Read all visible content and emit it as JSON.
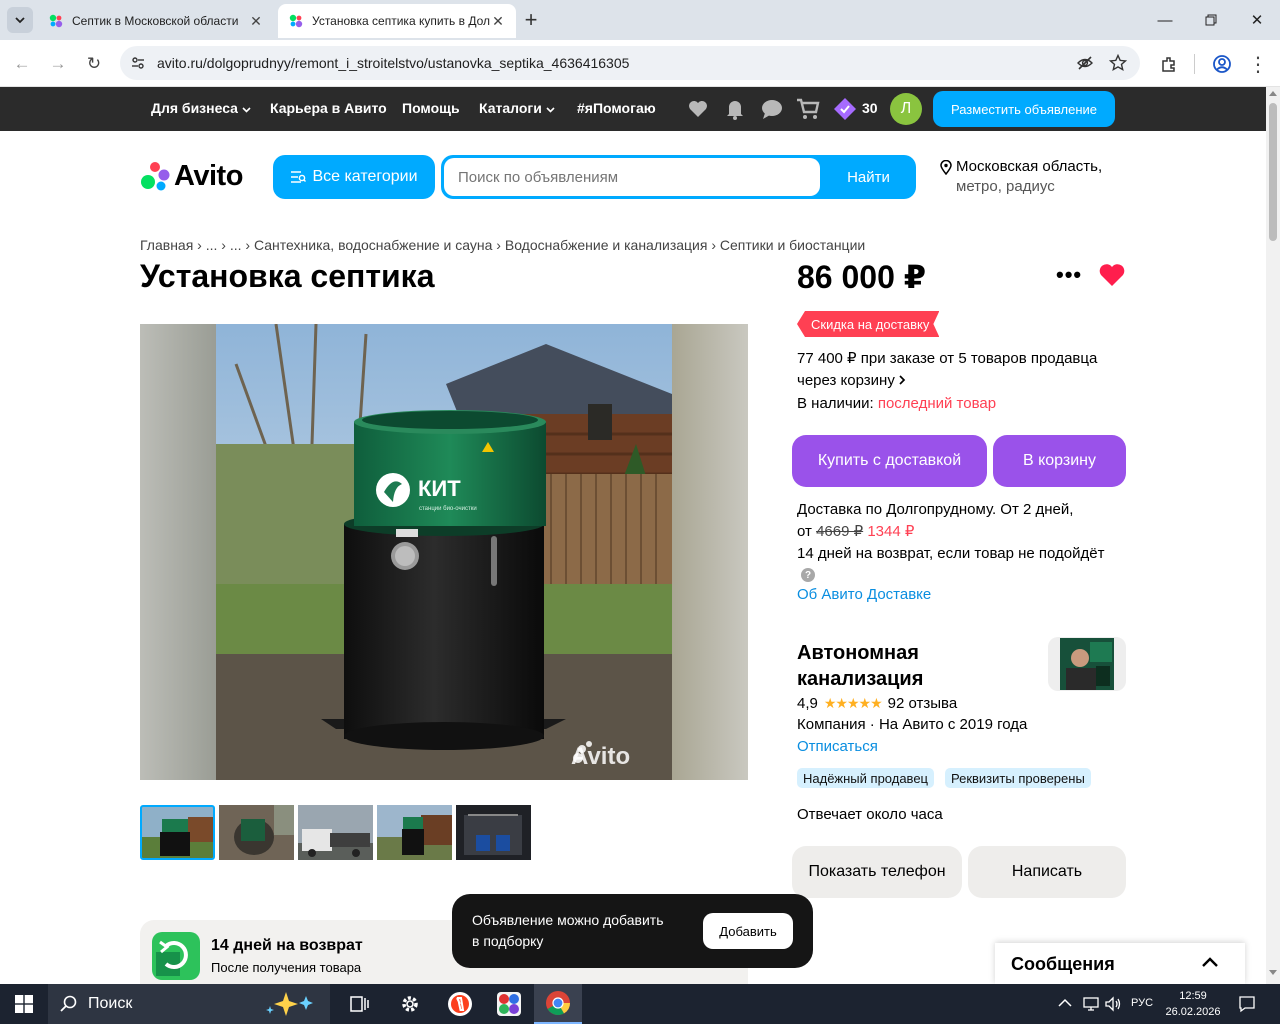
{
  "browser": {
    "tabs": [
      {
        "title": "Септик в Московской области"
      },
      {
        "title": "Установка септика купить в Долгопрудном"
      }
    ],
    "new_tab_symbol": "+",
    "url": "avito.ru/dolgoprudnyy/remont_i_stroitelstvo/ustanovka_septika_4636416305"
  },
  "topnav": {
    "items": [
      "Для бизнеса",
      "Карьера в Авито",
      "Помощь",
      "Каталоги",
      "#яПомогаю"
    ],
    "bonus_count": "30",
    "avatar_letter": "Л",
    "post_button": "Разместить объявление"
  },
  "header": {
    "logo": "Avito",
    "categories_button": "Все категории",
    "search_placeholder": "Поиск по объявлениям",
    "search_button": "Найти",
    "location_line1": "Московская область,",
    "location_line2": "метро, радиус"
  },
  "breadcrumbs": [
    "Главная",
    "...",
    "...",
    "Сантехника, водоснабжение и сауна",
    "Водоснабжение и канализация",
    "Септики и биостанции"
  ],
  "listing": {
    "title": "Установка септика",
    "price": "86 000 ₽",
    "delivery_discount_badge": "Скидка на доставку",
    "bulk_price_line1": "77 400 ₽ при заказе от 5 товаров продавца",
    "bulk_price_line2": "через корзину",
    "availability_label": "В наличии:",
    "availability_value": "последний товар",
    "buy_button": "Купить с доставкой",
    "cart_button": "В корзину",
    "delivery_line1": "Доставка по Долгопрудному. От 2 дней,",
    "delivery_from": "от",
    "delivery_old_price": "4669 ₽",
    "delivery_new_price": "1344 ₽",
    "return_text": "14 дней на возврат, если товар не подойдёт",
    "about_delivery_link": "Об Авито Доставке",
    "photo_watermark": "Avito",
    "tank_brand": "КИТ",
    "tank_subtitle": "станции био-очистки"
  },
  "seller": {
    "name_line1": "Автономная",
    "name_line2": "канализация",
    "rating": "4,9",
    "stars": 5,
    "reviews": "92 отзыва",
    "info": "Компания · На Авито с 2019 года",
    "unsubscribe": "Отписаться",
    "tags": [
      "Надёжный продавец",
      "Реквизиты проверены"
    ],
    "response_time": "Отвечает около часа",
    "phone_button": "Показать телефон",
    "write_button": "Написать"
  },
  "return_banner": {
    "title": "14 дней на возврат",
    "subtitle": "После получения товара"
  },
  "toast": {
    "text_line1": "Объявление можно добавить",
    "text_line2": "в подборку",
    "button": "Добавить"
  },
  "messages": {
    "title": "Сообщения"
  },
  "taskbar": {
    "search_label": "Поиск",
    "language": "РУС",
    "time": "12:59",
    "date": "26.02.2026"
  },
  "colors": {
    "avito_blue": "#00aaff",
    "purple": "#9a52ea",
    "red": "#ff4053",
    "link_blue": "#0a8ee0",
    "dark_nav": "#2b2b2b"
  }
}
